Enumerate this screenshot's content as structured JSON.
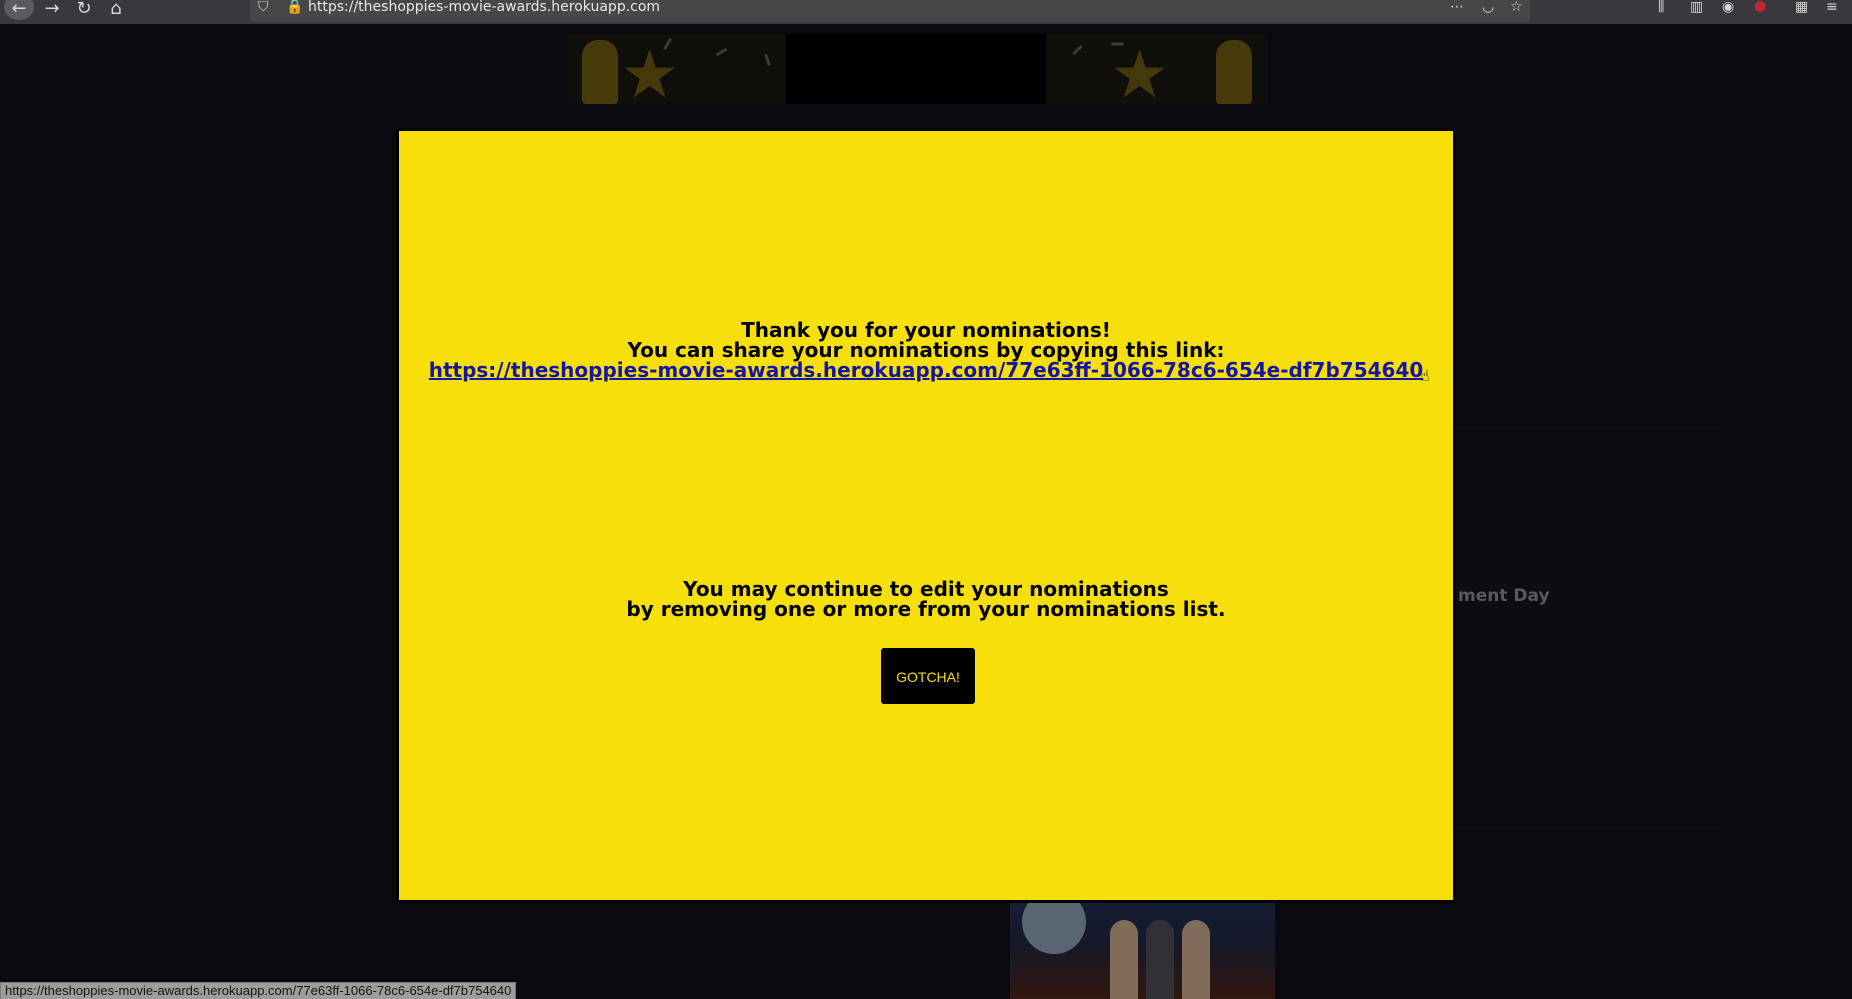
{
  "browser": {
    "url": "https://theshoppies-movie-awards.herokuapp.com",
    "back_icon": "arrow-left-icon",
    "forward_icon": "arrow-right-icon",
    "reload_icon": "reload-icon",
    "home_icon": "home-icon"
  },
  "background": {
    "partial_text": "ment Day"
  },
  "modal": {
    "line1": "Thank you for your nominations!",
    "line2": "You can share your nominations by copying this link:",
    "share_link": "https://theshoppies-movie-awards.herokuapp.com/77e63ff-1066-78c6-654e-df7b754640",
    "line3": "You may continue to edit your nominations",
    "line4": "by removing one or more from your nominations list.",
    "button_label": "GOTCHA!"
  },
  "status_bar": {
    "text": "https://theshoppies-movie-awards.herokuapp.com/77e63ff-1066-78c6-654e-df7b754640"
  },
  "colors": {
    "modal_background": "#f6df0a",
    "link": "#1414a6",
    "page_background": "#100e16"
  }
}
